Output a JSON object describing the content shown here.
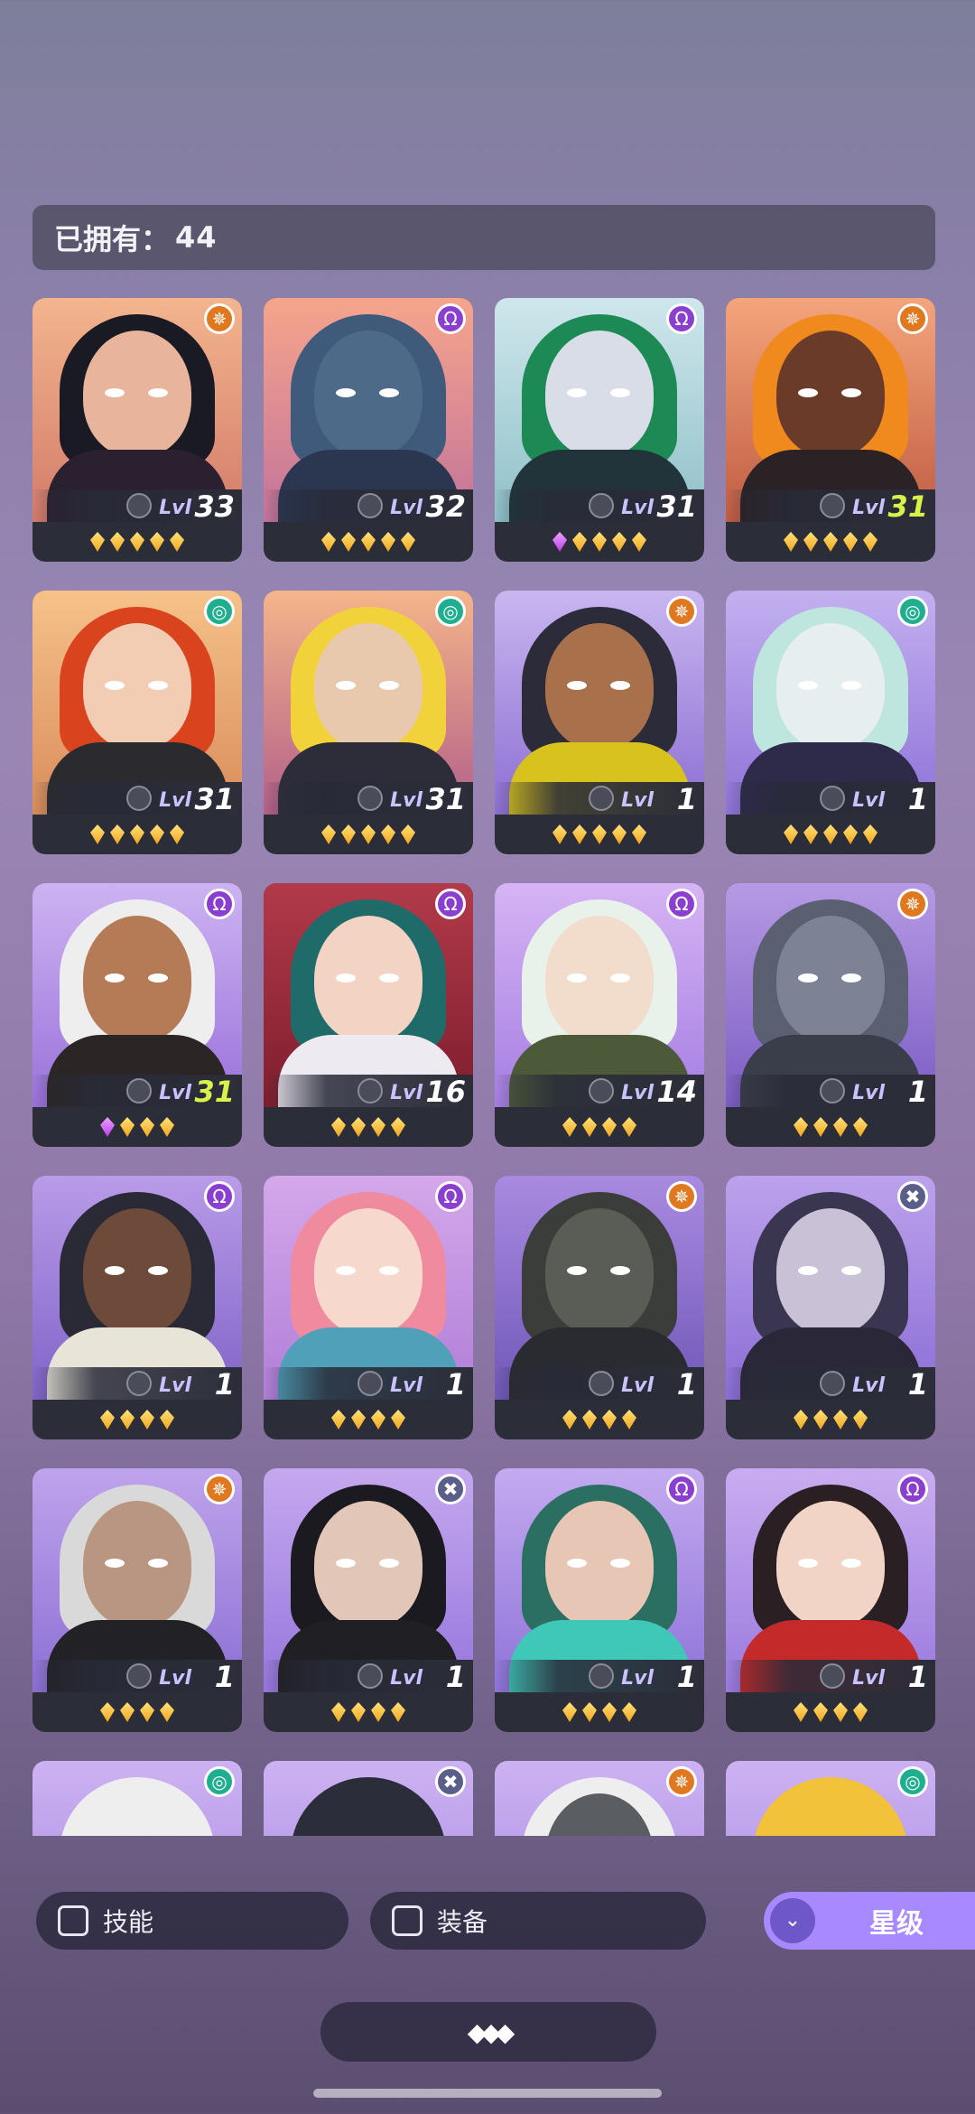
{
  "header": {
    "owned_label": "已拥有：",
    "owned_count": "44"
  },
  "filters": {
    "skill_label": "技能",
    "equipment_label": "装备",
    "star_label": "星级"
  },
  "heroes": [
    {
      "level": "33",
      "faction": "sun",
      "stars": 5,
      "bg": [
        "#f3b58e",
        "#d37b6a"
      ],
      "hair": "#1a1a24",
      "skin": "#e8b59c",
      "outfit": "#2a2030"
    },
    {
      "level": "32",
      "faction": "shadow",
      "stars": 5,
      "bg": [
        "#f6a58c",
        "#c3739a"
      ],
      "hair": "#3f5a7a",
      "skin": "#4d6a88",
      "outfit": "#2b3650"
    },
    {
      "level": "31",
      "faction": "shadow",
      "stars": 5,
      "purple": 1,
      "bg": [
        "#cfe7ec",
        "#8fc0c8"
      ],
      "hair": "#1d8a56",
      "skin": "#d8dde8",
      "outfit": "#20343a"
    },
    {
      "level": "31",
      "max": true,
      "faction": "sun",
      "stars": 5,
      "bg": [
        "#f4a57c",
        "#c05c42"
      ],
      "hair": "#f08a1e",
      "skin": "#6b3b2a",
      "outfit": "#2b2226"
    },
    {
      "level": "31",
      "faction": "nature",
      "stars": 5,
      "bg": [
        "#f6c28a",
        "#d98c5c"
      ],
      "hair": "#d9441e",
      "skin": "#f2cdb4",
      "outfit": "#2a2a2f"
    },
    {
      "level": "31",
      "faction": "nature",
      "stars": 5,
      "bg": [
        "#f5b58a",
        "#b35f8a"
      ],
      "hair": "#f2d23a",
      "skin": "#e8c9ae",
      "outfit": "#2d2d3a"
    },
    {
      "level": "1",
      "faction": "sun",
      "stars": 5,
      "bg": [
        "#c9b6f0",
        "#8c6fd2"
      ],
      "hair": "#2b2b3a",
      "skin": "#a8714c",
      "outfit": "#d7c21e"
    },
    {
      "level": "1",
      "faction": "nature",
      "stars": 5,
      "bg": [
        "#c3b0f0",
        "#8f73d8"
      ],
      "hair": "#bfe6de",
      "skin": "#e6eef0",
      "outfit": "#2e2a4a"
    },
    {
      "level": "31",
      "max": true,
      "faction": "shadow",
      "stars": 4,
      "purple": 1,
      "bg": [
        "#cdb3f2",
        "#9a72da"
      ],
      "hair": "#eeeeee",
      "skin": "#b57a56",
      "outfit": "#2b2625"
    },
    {
      "level": "16",
      "faction": "shadow",
      "stars": 4,
      "bg": [
        "#b23a4a",
        "#7e1e2e"
      ],
      "hair": "#1f6b6a",
      "skin": "#f2d3c4",
      "outfit": "#eeeaf2"
    },
    {
      "level": "14",
      "faction": "shadow",
      "stars": 4,
      "bg": [
        "#d6b4f4",
        "#a57ee2"
      ],
      "hair": "#e8f2ea",
      "skin": "#f2dccc",
      "outfit": "#4c5a3a"
    },
    {
      "level": "1",
      "faction": "sun",
      "stars": 4,
      "bg": [
        "#b69ae4",
        "#7c5dc4"
      ],
      "hair": "#5a5f72",
      "skin": "#7d8394",
      "outfit": "#3a3d4a"
    },
    {
      "level": "1",
      "faction": "shadow",
      "stars": 4,
      "bg": [
        "#b99be8",
        "#8064c8"
      ],
      "hair": "#2a2a36",
      "skin": "#6d4a3a",
      "outfit": "#e8e4d8"
    },
    {
      "level": "1",
      "faction": "shadow",
      "stars": 4,
      "bg": [
        "#d4a8ea",
        "#b07ed8"
      ],
      "hair": "#f08a9e",
      "skin": "#f6d8cc",
      "outfit": "#4fa0b8"
    },
    {
      "level": "1",
      "faction": "sun",
      "stars": 4,
      "bg": [
        "#a98ae0",
        "#7058b8"
      ],
      "hair": "#3a3d3a",
      "skin": "#5a5d55",
      "outfit": "#2a2b30"
    },
    {
      "level": "1",
      "faction": "void",
      "stars": 4,
      "bg": [
        "#bca2ec",
        "#8b6ed6"
      ],
      "hair": "#3a3550",
      "skin": "#c9c2d6",
      "outfit": "#2a2838"
    },
    {
      "level": "1",
      "faction": "sun",
      "stars": 4,
      "bg": [
        "#bfa3ec",
        "#8c70d4"
      ],
      "hair": "#d9d9d9",
      "skin": "#b89682",
      "outfit": "#222226"
    },
    {
      "level": "1",
      "faction": "void",
      "stars": 4,
      "bg": [
        "#c5a8ef",
        "#9676dc"
      ],
      "hair": "#1a1a20",
      "skin": "#e2c7b8",
      "outfit": "#1f1f24"
    },
    {
      "level": "1",
      "faction": "shadow",
      "stars": 4,
      "bg": [
        "#c4aaf0",
        "#8e73d8"
      ],
      "hair": "#2b6e62",
      "skin": "#e8c6b6",
      "outfit": "#3fc7b8"
    },
    {
      "level": "1",
      "faction": "shadow",
      "stars": 4,
      "bg": [
        "#c9acf0",
        "#9a7ade"
      ],
      "hair": "#2a1f22",
      "skin": "#f2d4c6",
      "outfit": "#c42a2a"
    },
    {
      "level": "",
      "faction": "nature",
      "stars": 0,
      "bg": [
        "#cdb2f2",
        "#a283e0"
      ],
      "hair": "#eeeeee",
      "skin": "#eeeeee",
      "outfit": "#d8d8e8"
    },
    {
      "level": "",
      "faction": "void",
      "stars": 0,
      "bg": [
        "#cdb2f2",
        "#a283e0"
      ],
      "hair": "#2b2e3a",
      "skin": "#2b2e3a",
      "outfit": "#2b2e3a"
    },
    {
      "level": "",
      "faction": "sun",
      "stars": 0,
      "bg": [
        "#cdb2f2",
        "#a283e0"
      ],
      "hair": "#eeeeee",
      "skin": "#5a5d62",
      "outfit": "#5a5d62"
    },
    {
      "level": "",
      "faction": "nature",
      "stars": 0,
      "bg": [
        "#cdb2f2",
        "#a283e0"
      ],
      "hair": "#f2c23a",
      "skin": "#f2c23a",
      "outfit": "#f2c23a"
    }
  ]
}
